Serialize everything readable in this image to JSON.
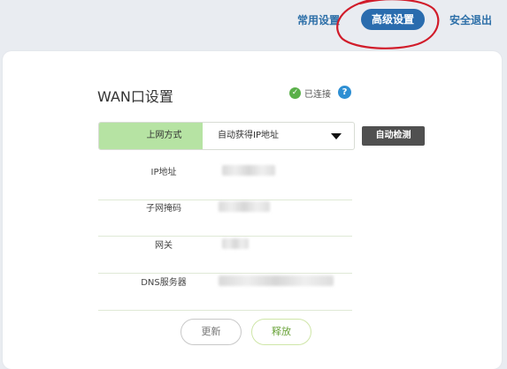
{
  "nav": {
    "common_settings": "常用设置",
    "advanced_settings": "高级设置",
    "safe_logout": "安全退出"
  },
  "wan": {
    "title": "WAN口设置",
    "status_text": "已连接",
    "status_color": "#5ab04a",
    "help_icon": "?",
    "mode_label": "上网方式",
    "mode_value": "自动获得IP地址",
    "detect_button": "自动检测",
    "fields": {
      "ip_label": "IP地址",
      "mask_label": "子网掩码",
      "gateway_label": "网关",
      "dns_label": "DNS服务器"
    }
  },
  "buttons": {
    "update": "更新",
    "release": "释放"
  },
  "colors": {
    "accent_blue": "#2a6cae",
    "mode_label_bg": "#b6e3a3",
    "annotation_red": "#d11c2a"
  },
  "icons": {
    "status": "check-circle-icon",
    "help": "help-icon",
    "dropdown": "caret-down-icon"
  }
}
